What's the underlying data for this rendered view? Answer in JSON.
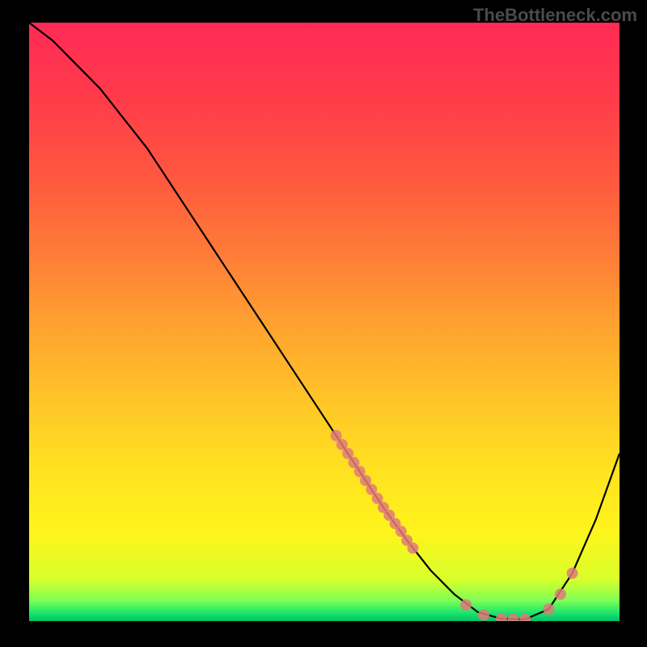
{
  "watermark": "TheBottleneck.com",
  "chart_data": {
    "type": "line",
    "title": "",
    "xlabel": "",
    "ylabel": "",
    "xlim": [
      0,
      100
    ],
    "ylim": [
      0,
      100
    ],
    "curve": {
      "x": [
        0,
        4,
        8,
        12,
        16,
        20,
        24,
        28,
        32,
        36,
        40,
        44,
        48,
        52,
        56,
        60,
        64,
        68,
        72,
        76,
        80,
        84,
        88,
        92,
        96,
        100
      ],
      "y": [
        100,
        97,
        93,
        89,
        84,
        79,
        73,
        67,
        61,
        55,
        49,
        43,
        37,
        31,
        25,
        19,
        13.5,
        8.5,
        4.5,
        1.5,
        0.4,
        0.3,
        2.0,
        8.0,
        17,
        28
      ]
    },
    "marker_series": {
      "name": "highlighted points",
      "color": "#e07a7a",
      "x": [
        52,
        53,
        54,
        55,
        56,
        57,
        58,
        59,
        60,
        61,
        62,
        63,
        64,
        65,
        74,
        77,
        80,
        82,
        84,
        88,
        90,
        92
      ],
      "y": [
        31,
        29.5,
        28,
        26.5,
        25,
        23.5,
        22,
        20.5,
        19,
        17.7,
        16.3,
        15,
        13.5,
        12.2,
        2.7,
        1.0,
        0.4,
        0.3,
        0.3,
        2.0,
        4.5,
        8.0
      ]
    },
    "gradient_stops": [
      {
        "offset": 0.0,
        "color": "#ff2a55"
      },
      {
        "offset": 0.12,
        "color": "#ff3a4a"
      },
      {
        "offset": 0.25,
        "color": "#ff5540"
      },
      {
        "offset": 0.38,
        "color": "#ff7a38"
      },
      {
        "offset": 0.5,
        "color": "#ffa030"
      },
      {
        "offset": 0.62,
        "color": "#ffc228"
      },
      {
        "offset": 0.74,
        "color": "#ffe020"
      },
      {
        "offset": 0.85,
        "color": "#fff41c"
      },
      {
        "offset": 0.93,
        "color": "#d8ff2a"
      },
      {
        "offset": 0.965,
        "color": "#80ff55"
      },
      {
        "offset": 0.985,
        "color": "#20e86a"
      },
      {
        "offset": 1.0,
        "color": "#00c068"
      }
    ]
  }
}
